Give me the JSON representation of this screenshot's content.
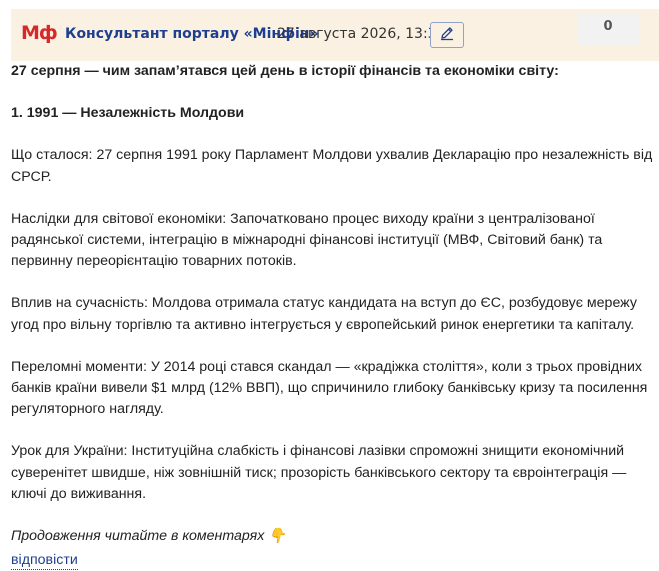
{
  "header": {
    "logo_text": "Мф",
    "author": "Консультант порталу «Мінфін»",
    "timestamp": "27 августа 2026, 13:37",
    "vote_count": "0",
    "edit_icon": "pencil-icon"
  },
  "post": {
    "heading": "27 серпня — чим запам’ятався цей день в історії фінансів та економіки світу:",
    "section_title": "1. 1991 — Незалежність Молдови",
    "what_happened": "Що сталося: 27 серпня 1991 року Парламент Молдови ухвалив Декларацію про незалежність від СРСР.",
    "consequences": "Наслідки для світової економіки: Започатковано процес виходу країни з централізованої радянської системи, інтеграцію в міжнародні фінансові інституції (МВФ, Світовий банк) та первинну переорієнтацію товарних потоків.",
    "influence": "Вплив на сучасність: Молдова отримала статус кандидата на вступ до ЄС, розбудовує мережу угод про вільну торгівлю та активно інтегрується у європейський ринок енергетики та капіталу.",
    "turning_points": "Переломні моменти: У 2014 році стався скандал — «крадіжка століття», коли з трьох провідних банків країни вивели $1 млрд (12% ВВП), що спричинило глибоку банківську кризу та посилення регуляторного нагляду.",
    "lesson": "Урок для України: Інституційна слабкість і фінансові лазівки спроможні знищити економічний суверенітет швидше, ніж зовнішній тиск; прозорість банківського сектору та євроінтеграція — ключі до виживання.",
    "continue_note": "Продовження читайте в коментарях 👇",
    "reply_label": "відповісти"
  },
  "colors": {
    "header_bg": "#fbf1e3",
    "author_link": "#1e3f8f",
    "logo_red": "#d42a2a"
  }
}
